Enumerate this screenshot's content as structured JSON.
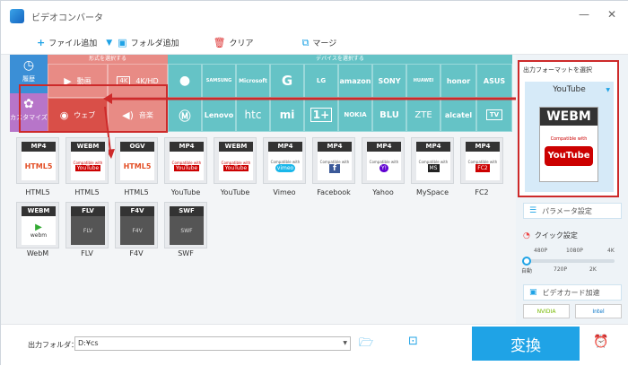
{
  "app": {
    "title": "ビデオコンバータ"
  },
  "toolbar": {
    "add_file": "ファイル追加",
    "add_folder": "フォルダ追加",
    "clear": "クリア",
    "merge": "マージ"
  },
  "left": {
    "history": "履歴",
    "custom": "カスタマイズ"
  },
  "format_section": {
    "header": "形式を選択する",
    "items": [
      "動画",
      "4K/HD",
      "ウェブ",
      "音楽"
    ]
  },
  "device_section": {
    "header": "デバイスを選択する",
    "row1": [
      "",
      "SAMSUNG",
      "Microsoft",
      "G",
      "LG",
      "amazon",
      "SONY",
      "HUAWEI",
      "honor",
      "ASUS"
    ],
    "row2": [
      "",
      "Lenovo",
      "htc",
      "mi",
      "1+",
      "NOKIA",
      "BLU",
      "ZTE",
      "alcatel",
      "TV"
    ]
  },
  "grid": {
    "tiles": [
      {
        "badge": "MP4",
        "label": "HTML5",
        "art": "HTML5"
      },
      {
        "badge": "WEBM",
        "label": "HTML5",
        "art": "YouTube"
      },
      {
        "badge": "OGV",
        "label": "HTML5",
        "art": "HTML5"
      },
      {
        "badge": "MP4",
        "label": "YouTube",
        "art": "YouTube"
      },
      {
        "badge": "WEBM",
        "label": "YouTube",
        "art": "YouTube"
      },
      {
        "badge": "MP4",
        "label": "Vimeo",
        "art": "vimeo"
      },
      {
        "badge": "MP4",
        "label": "Facebook",
        "art": "f"
      },
      {
        "badge": "MP4",
        "label": "Yahoo",
        "art": "Y!"
      },
      {
        "badge": "MP4",
        "label": "MySpace",
        "art": "MS"
      },
      {
        "badge": "MP4",
        "label": "FC2",
        "art": "FC2"
      },
      {
        "badge": "WEBM",
        "label": "WebM",
        "art": "webm"
      },
      {
        "badge": "FLV",
        "label": "FLV",
        "art": "FLV"
      },
      {
        "badge": "F4V",
        "label": "F4V",
        "art": "F4V"
      },
      {
        "badge": "SWF",
        "label": "SWF",
        "art": "SWF"
      }
    ],
    "compat": "Compatible with"
  },
  "right": {
    "output_title": "出力フォーマットを選択",
    "output_value": "YouTube",
    "preview_badge": "WEBM",
    "preview_compat": "Compatible with",
    "preview_logo": "YouTube",
    "param": "パラメータ設定",
    "quick": "クイック設定",
    "res_top": [
      "480P",
      "1080P",
      "4K"
    ],
    "res_bottom": [
      "自動",
      "720P",
      "2K"
    ],
    "gpu": "ビデオカード加速",
    "nvidia": "NVIDIA",
    "intel": "Intel"
  },
  "bottom": {
    "folder_label": "出力フォルダ：",
    "folder_value": "D:¥cs",
    "convert": "変換"
  },
  "colors": {
    "accent": "#1fa3e6",
    "format": "#e88b85",
    "device": "#65c3c6",
    "highlight": "#cd2a2a"
  }
}
